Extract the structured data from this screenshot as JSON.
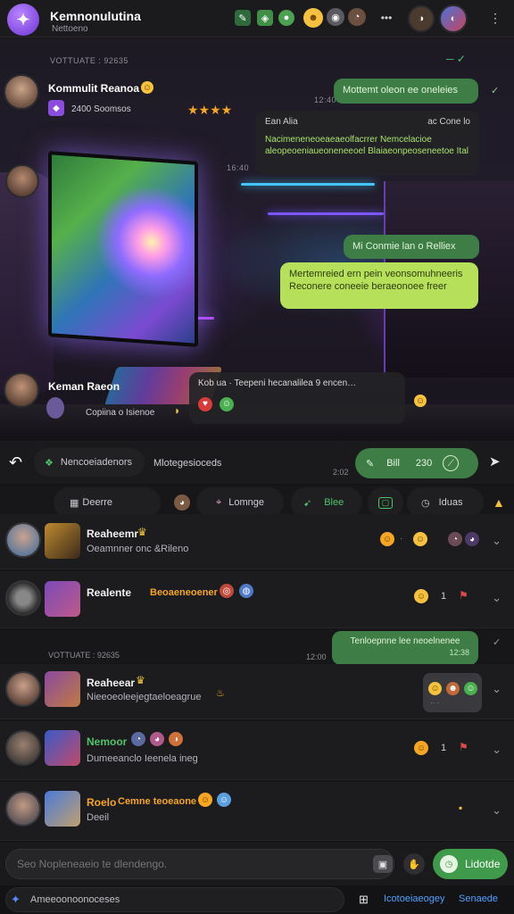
{
  "app": {
    "title": "Kemnonulutina",
    "subtitle": "Nettoeno"
  },
  "scene": {
    "tag_top": "VOTTUATE : 92635",
    "host_name": "Kommulit Reanoa",
    "host_sub": "2400 Soomsos",
    "stars": "★★★★",
    "host2_name": "Keman Raeon",
    "host2_sub": "Copiina o Isienoe",
    "time_a": "12:40",
    "time_b": "16:40",
    "bubbles": {
      "b1": "Mottemt oleon ee oneleies",
      "b2_head_left": "Ean Alia",
      "b2_head_right": "ac Cone lo",
      "b2_body": "Nacimeneneoeaeaeolfacrrer Nemcelacioe aleopeoeniaueoneneeoel Blaiaeonpeoseneetoe Ital",
      "b3": "Mi Conmie      lan o Relliex",
      "b4": "Mertemreied ern pein veonsomuhneeris Reconere coneeie beraeonoee freer",
      "b5": "Kob ua · Teepeni hecanalilea 9 encen…"
    }
  },
  "action_bar": {
    "reply_icon": "↶",
    "tab_primary": "Nencoeiadenors",
    "tab_secondary": "Mlotegesioceds",
    "time": "2:02",
    "btn_a": "Bill",
    "btn_b": "230"
  },
  "filters": [
    {
      "label": "Deerre",
      "icon": "grid-icon"
    },
    {
      "label": "Lomnge",
      "icon": "tag-icon"
    },
    {
      "label": "Blee",
      "icon": "tag-icon"
    },
    {
      "label": "",
      "icon": "box-icon"
    },
    {
      "label": "Iduas",
      "icon": "clock-icon"
    }
  ],
  "rows": [
    {
      "name": "Reaheemr",
      "msg": "Oeamnner onc &Rileno",
      "num": ""
    },
    {
      "name": "Realente",
      "msg": "",
      "badge": "Beoaeneoener",
      "num": "1"
    },
    {
      "name": "Reaheear",
      "msg": "Nieeoeoleejegtaeloeagrue",
      "num": ""
    },
    {
      "name": "Nemoor",
      "msg": "Dumeeanclo Ieenela ineg",
      "num": "1"
    },
    {
      "name": "Roelo",
      "msg": "Deeil",
      "badge": "Cemne teoeaone",
      "num": ""
    }
  ],
  "thread": {
    "tag": "VOTTUATE : 92635",
    "time": "12:00",
    "bubble_line1": "Tenloepnne lee neoelnenee",
    "bubble_line2": "12:38"
  },
  "composer": {
    "placeholder": "Seo Nopleneaeio te dlendengo.",
    "send_label": "Lidotde"
  },
  "footer": {
    "left_label": "Ameeoonoonoceses",
    "link_a": "Icotoeiaeogey",
    "link_b": "Senaede"
  },
  "colors": {
    "accent_green": "#3f7d46",
    "accent_lime": "#b6e05a",
    "brand_purple": "#7b3fe4",
    "background": "#151517"
  }
}
